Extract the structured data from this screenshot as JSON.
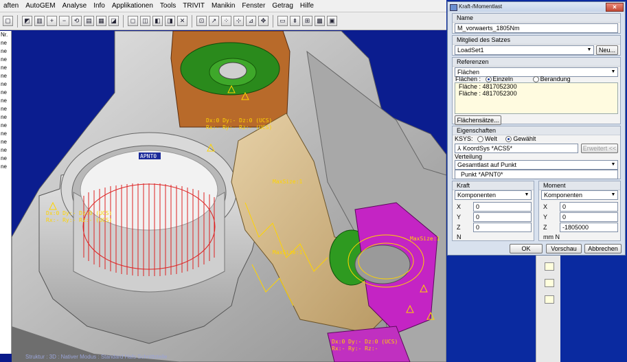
{
  "menu": [
    "aften",
    "AutoGEM",
    "Analyse",
    "Info",
    "Applikationen",
    "Tools",
    "TRIVIT",
    "Manikin",
    "Fenster",
    "Getrag",
    "Hilfe"
  ],
  "left_panel": [
    "Nr.",
    "ne",
    "ne",
    "",
    "",
    "",
    "",
    "",
    "ne",
    "ne",
    "ne",
    "ne",
    "ne",
    "ne",
    "ne",
    "ne",
    "ne",
    "ne",
    "ne",
    "ne",
    "ne",
    "ne"
  ],
  "status_text": "Struktur : 3D : Nativer Modus : Standard Hafs Schnittstelle",
  "viewport_labels": [
    "APNT0",
    "Dx:0 Dy:- Dz:0 (UCS)",
    "Rx:- Ry:- Rz:- (UCS)",
    "Dx:0 Dy:- Dz:0 (UCS)",
    "Rx:- Ry:- Rz:- (UCS)",
    "MaxSize:1",
    "MaxSize:1",
    "MaxSize:1",
    "Dx:0 Dy:- Dz:0 (UCS)",
    "Rx:- Ry:- Rz:-"
  ],
  "dialog": {
    "title": "Kraft-/Momentlast",
    "name_header": "Name",
    "name_value": "M_vorwaerts_1805Nm",
    "member_header": "Mitglied des Satzes",
    "member_value": "LoadSet1",
    "new_button": "Neu...",
    "refs_header": "Referenzen",
    "refs_type": "Flächen",
    "refs_label": "Flächen :",
    "radio_single": "Einzeln",
    "radio_boundary": "Berandung",
    "ref_items": [
      "Fläche : 4817052300",
      "Fläche : 4817052300"
    ],
    "surface_sets_button": "Flächensätze...",
    "props_header": "Eigenschaften",
    "ksys_label": "KSYS:",
    "radio_world": "Welt",
    "radio_selected": "Gewählt",
    "ksys_value": "KoordSys *ACS5*",
    "advanced_button": "Erweitert <<",
    "distribution_label": "Verteilung",
    "distribution_value": "Gesamtlast auf Punkt",
    "point_value": "Punkt *APNT0*",
    "force_header": "Kraft",
    "force_mode": "Komponenten",
    "force": {
      "x": "0",
      "y": "0",
      "z": "0",
      "unit": "N"
    },
    "moment_header": "Moment",
    "moment_mode": "Komponenten",
    "moment": {
      "x": "0",
      "y": "0",
      "z": "-1805000",
      "unit": "mm N"
    },
    "ok": "OK",
    "preview": "Vorschau",
    "cancel": "Abbrechen"
  }
}
